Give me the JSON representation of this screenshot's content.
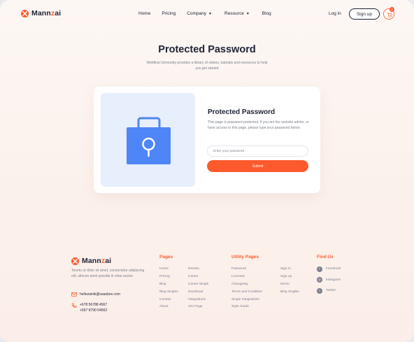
{
  "brand": {
    "name_main": "Mann",
    "name_accent": "z",
    "name_end": "ai",
    "accent_color": "#ff5a2c"
  },
  "nav": {
    "items": [
      {
        "label": "Home",
        "has_dropdown": false
      },
      {
        "label": "Pricing",
        "has_dropdown": false
      },
      {
        "label": "Company",
        "has_dropdown": true
      },
      {
        "label": "Resource",
        "has_dropdown": true
      },
      {
        "label": "Blog",
        "has_dropdown": false
      }
    ],
    "login_label": "Log in",
    "signup_label": "Sign up",
    "cart_icon": "cart-icon",
    "cart_count": "0"
  },
  "hero": {
    "title": "Protected Password",
    "subtitle": "Webflow University provides a library of videos, tutorials and resources to help you get started"
  },
  "form": {
    "title": "Protected Password",
    "description": "This page is password protected. If you are the website admin, or have access to this page, please type your password below.",
    "password_placeholder": "Enter your password",
    "submit_label": "Submit",
    "illustration_icon": "lock-icon"
  },
  "footer": {
    "description": "Tenetu ut dolor sit amet, consectetur adipiscing elit, ultrices amet gravida in vitae auctor.",
    "email": "hellozainik@saasbox.com",
    "phones": [
      "+678 56788 4567",
      "+567 8790 54563"
    ],
    "pages": {
      "heading": "Pages",
      "col1": [
        "Home",
        "Pricing",
        "Blog",
        "Blog Singles",
        "Contact",
        "About"
      ],
      "col2": [
        "Review",
        "Career",
        "Career Single",
        "Download",
        "Integrations",
        "404 Page"
      ]
    },
    "utility": {
      "heading": "Utility Pages",
      "col1": [
        "Password",
        "Licenses",
        "Changelog",
        "Terms and Condition",
        "Single Integrations",
        "Style Guide"
      ],
      "col2": [
        "Sign in",
        "Sign up",
        "Demo",
        "Blog Singles"
      ]
    },
    "find_us": {
      "heading": "Find Us",
      "items": [
        {
          "label": "Facebook",
          "icon": "facebook-icon",
          "glyph": "f"
        },
        {
          "label": "Instagram",
          "icon": "instagram-icon",
          "glyph": "◎"
        },
        {
          "label": "Twitter",
          "icon": "twitter-icon",
          "glyph": "t"
        }
      ]
    }
  }
}
